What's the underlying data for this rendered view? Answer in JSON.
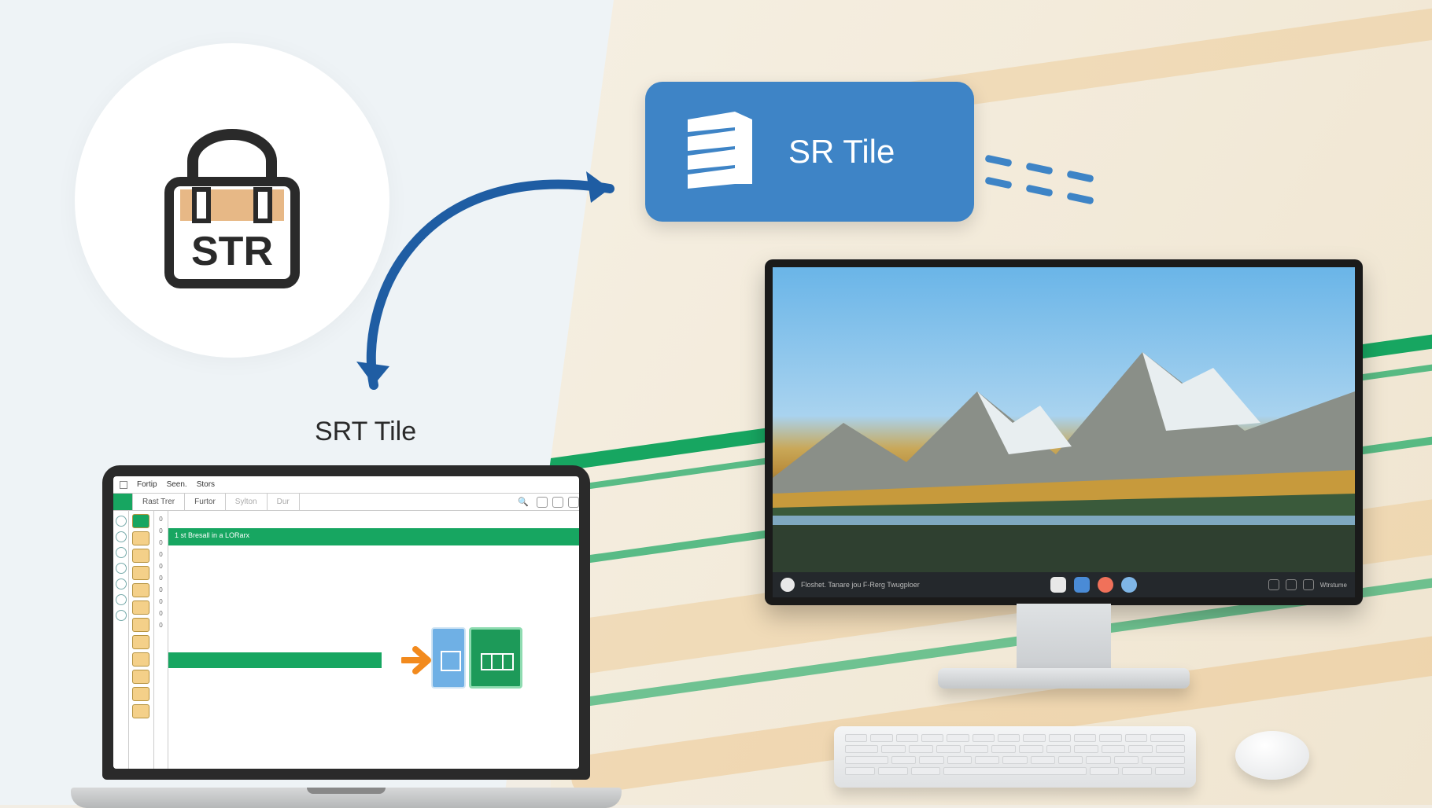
{
  "str_badge": {
    "text": "STR"
  },
  "sr_tile": {
    "label": "SR Tile"
  },
  "srt_caption": "SRT Tile",
  "laptop_app": {
    "menu": [
      "Fortip",
      "Seen.",
      "Stors"
    ],
    "toolbar": {
      "col1": "Rast Trer",
      "col2": "Furtor",
      "col3": "Sylton",
      "col4": "Dur"
    },
    "header_bar": "1 st Bresall in a LORarx",
    "numbers": [
      "0",
      "0",
      "0",
      "0",
      "0",
      "0",
      "0",
      "0",
      "0",
      "0"
    ]
  },
  "monitor_taskbar": {
    "text": "Floshet. Tanare jou F-Rerg Twugploer",
    "label_right": "Wtrstume"
  }
}
